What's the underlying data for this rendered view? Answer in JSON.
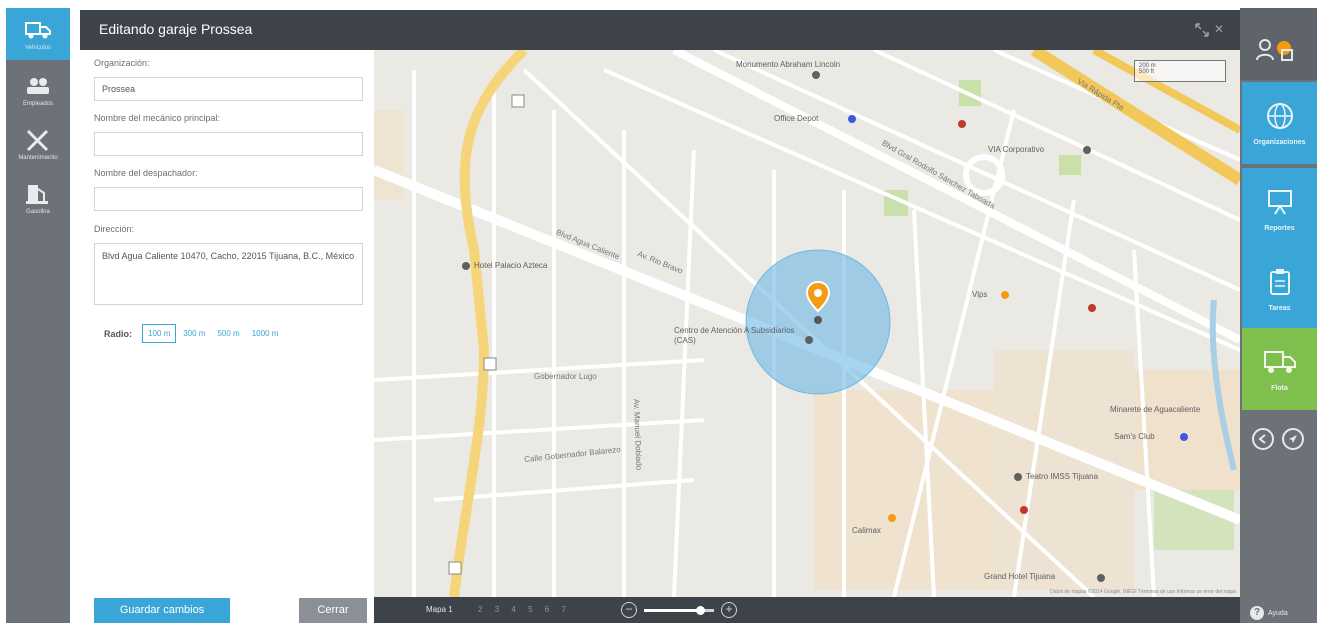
{
  "window": {
    "title": "Editando garaje Prossea"
  },
  "leftnav": {
    "items": [
      {
        "label": "Vehículos",
        "icon": "truck-icon"
      },
      {
        "label": "Empleados",
        "icon": "people-icon"
      },
      {
        "label": "Mantenimiento",
        "icon": "tools-icon"
      },
      {
        "label": "Gasolina",
        "icon": "fuel-icon"
      }
    ]
  },
  "form": {
    "org_label": "Organización:",
    "org_value": "Prossea",
    "mechanic_label": "Nombre del mecánico principal:",
    "mechanic_value": "",
    "dispatcher_label": "Nombre del despachador:",
    "dispatcher_value": "",
    "address_label": "Dirección:",
    "address_value": "Blvd Agua Caliente 10470, Cacho, 22015 Tijuana, B.C., México",
    "radius_label": "Radio:",
    "radius_options": [
      "100 m",
      "300 m",
      "500 m",
      "1000 m"
    ],
    "radius_selected": "100 m",
    "save_label": "Guardar cambios",
    "close_label": "Cerrar"
  },
  "map": {
    "pois": [
      "Monumento Abraham Lincoln",
      "Office Depot",
      "VIA Corporativo",
      "Hotel Palacio Azteca",
      "Vips",
      "Centro de Atención A Subsidiarios (CAS)",
      "Minarete de Aguacaliente",
      "Sam's Club",
      "Teatro IMSS Tijuana",
      "Calimax",
      "Grand Hotel Tijuana"
    ],
    "streets": [
      "Blvd Agua Caliente",
      "Av. Rio Bravo",
      "Gobernador Lugo",
      "Calle Gobernador Balarezo",
      "Av. Manuel Doblado",
      "Blvd Gral Rodolfo Sánchez Taboada",
      "Via Rápida Pte"
    ],
    "scale": [
      "200 m",
      "500 ft"
    ],
    "attribution": "Datos de mapas ©2014 Google, INEGI   Términos de uso   Informar un error del mapa",
    "pin_color": "#f39c12",
    "radius_color": "#6cb8e6"
  },
  "mapbar": {
    "map_label": "Mapa 1",
    "pages": [
      "2",
      "3",
      "4",
      "5",
      "6",
      "7"
    ],
    "zoom_level": 0.8
  },
  "rightrail": {
    "items": [
      {
        "label": "Organizaciones",
        "icon": "globe-icon",
        "color": "#3aa6d8"
      },
      {
        "label": "Reportes",
        "icon": "presentation-icon",
        "color": "#3aa6d8"
      },
      {
        "label": "Tareas",
        "icon": "clipboard-icon",
        "color": "#3aa6d8"
      },
      {
        "label": "Flota",
        "icon": "truck-icon",
        "color": "#7fbf4d"
      }
    ],
    "help_label": "Ayuda"
  }
}
